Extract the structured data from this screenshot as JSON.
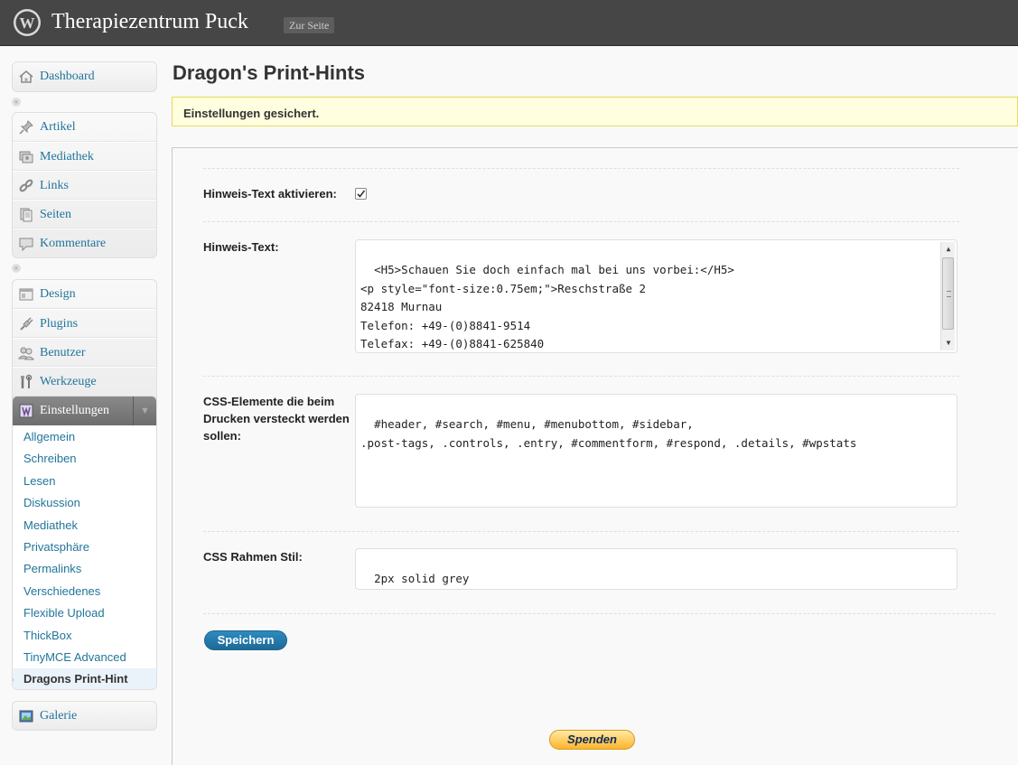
{
  "header": {
    "site_title": "Therapiezentrum Puck",
    "visit_site_label": "Zur Seite"
  },
  "sidebar": {
    "dashboard": "Dashboard",
    "group_content": [
      "Artikel",
      "Mediathek",
      "Links",
      "Seiten",
      "Kommentare"
    ],
    "group_admin": [
      "Design",
      "Plugins",
      "Benutzer",
      "Werkzeuge"
    ],
    "settings": {
      "label": "Einstellungen",
      "submenu": [
        "Allgemein",
        "Schreiben",
        "Lesen",
        "Diskussion",
        "Mediathek",
        "Privatsphäre",
        "Permalinks",
        "Verschiedenes",
        "Flexible Upload",
        "ThickBox",
        "TinyMCE Advanced"
      ],
      "current": "Dragons Print-Hint"
    },
    "galerie": "Galerie"
  },
  "main": {
    "title": "Dragon's Print-Hints",
    "notice": "Einstellungen gesichert.",
    "fields": {
      "activate_label": "Hinweis-Text aktivieren:",
      "activate_checked": true,
      "hint_label": "Hinweis-Text:",
      "hint_value": "<H5>Schauen Sie doch einfach mal bei uns vorbei:</H5>\n<p style=\"font-size:0.75em;\">Reschstraße 2\n82418 Murnau\nTelefon: +49-(0)8841-9514\nTelefax: +49-(0)8841-625840\nE-Mail: Praxis@Puck-Murnau.de<p>",
      "css_hide_label": "CSS-Elemente die beim Drucken versteckt werden sollen:",
      "css_hide_value": "#header, #search, #menu, #menubottom, #sidebar,\n.post-tags, .controls, .entry, #commentform, #respond, .details, #wpstats",
      "border_label": "CSS Rahmen Stil:",
      "border_value": "2px solid grey"
    },
    "save_label": "Speichern",
    "donate_label": "Spenden"
  },
  "colors": {
    "header_bg": "#464646",
    "link": "#21759b",
    "notice_bg": "#ffffe0",
    "notice_border": "#e6db55",
    "button_primary": "#21759b",
    "donate": "#ffb42b"
  }
}
